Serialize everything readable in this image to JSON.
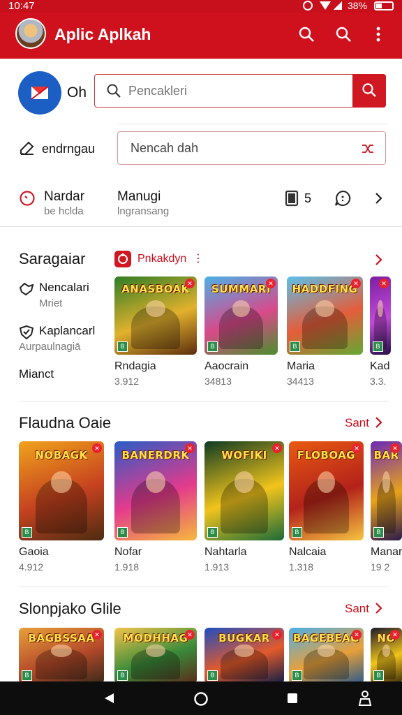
{
  "status_bar": {
    "time": "10:47",
    "battery": "38%"
  },
  "app_bar": {
    "title": "Aplic Aplkah",
    "avatar_icon": "knight-avatar",
    "search_icon": "search-icon",
    "search_icon_2": "search-icon",
    "menu_icon": "more-vert-icon"
  },
  "search_row": {
    "brand_label": "Oh",
    "placeholder": "Pencakleri",
    "search_button_icon": "search-icon"
  },
  "edit_row": {
    "label": "endrngau",
    "input_value": "Nencah dah",
    "clear_icon": "shuffle-icon"
  },
  "info_row": {
    "item1_title": "Nardar",
    "item1_sub": "be hclda",
    "item2_title": "Manugi",
    "item2_sub": "lngransang",
    "count": "5"
  },
  "section1": {
    "title": "Saragaiar",
    "chip_label": "Pnkakdyn",
    "side_items": [
      {
        "title": "Nencalari",
        "sub": "Mriet"
      },
      {
        "title": "Kaplancarl",
        "sub": "Aurpaulnagiā"
      },
      {
        "title": "Mianct",
        "sub": ""
      }
    ],
    "games": [
      {
        "name": "Rndagia",
        "num": "3.912",
        "art": "ANASBOAK",
        "colors": [
          "#2f7d26",
          "#e2b12d",
          "#5b2d0e"
        ]
      },
      {
        "name": "Aaocrain",
        "num": "34813",
        "art": "SUMMARI",
        "colors": [
          "#4bb0e8",
          "#d84a8a",
          "#4a8f2c"
        ]
      },
      {
        "name": "Maria",
        "num": "34413",
        "art": "HADDFING",
        "colors": [
          "#5bc0ea",
          "#e45d3a",
          "#63a932"
        ]
      },
      {
        "name": "Kad",
        "num": "3.3.",
        "art": "",
        "colors": [
          "#7b1fa2",
          "#c14bd8",
          "#26104a"
        ]
      }
    ]
  },
  "section2": {
    "title": "Flaudna Oaie",
    "see_all": "Sant",
    "games": [
      {
        "name": "Gaoia",
        "num": "4.912",
        "art": "NOBAGK",
        "colors": [
          "#f0a21c",
          "#c6421f",
          "#4c2b12"
        ]
      },
      {
        "name": "Nofar",
        "num": "1.918",
        "art": "BANERDRK",
        "colors": [
          "#2a5cc6",
          "#e43b8c",
          "#f5b93c"
        ]
      },
      {
        "name": "Nahtarla",
        "num": "1.913",
        "art": "WOFIKI",
        "colors": [
          "#0e3a22",
          "#f2c41c",
          "#1b6b38"
        ]
      },
      {
        "name": "Nalcaia",
        "num": "1.318",
        "art": "FLOBOAG",
        "colors": [
          "#e85a12",
          "#b3221a",
          "#f5c542"
        ]
      },
      {
        "name": "Manar",
        "num": "19 2",
        "art": "BAR",
        "colors": [
          "#6b2ab5",
          "#e8a21c",
          "#2a1a4a"
        ]
      }
    ]
  },
  "section3": {
    "title": "Slonpjako Glile",
    "see_all": "Sant",
    "games": [
      {
        "art": "BAGBSSAA",
        "colors": [
          "#e8a03a",
          "#b54a2a",
          "#3a2a1a"
        ]
      },
      {
        "art": "MODHHAG",
        "colors": [
          "#f2c64a",
          "#3a8a3a",
          "#5a2a1a"
        ]
      },
      {
        "art": "BUGKAR",
        "colors": [
          "#1e4ec2",
          "#e45a2a",
          "#0e1e4a"
        ]
      },
      {
        "art": "BAGEBEAG",
        "colors": [
          "#4ab0e8",
          "#e8a03a",
          "#2a5a8a"
        ]
      },
      {
        "art": "NO",
        "colors": [
          "#1a1a2a",
          "#f2c41c",
          "#3a2a0a"
        ]
      }
    ]
  }
}
